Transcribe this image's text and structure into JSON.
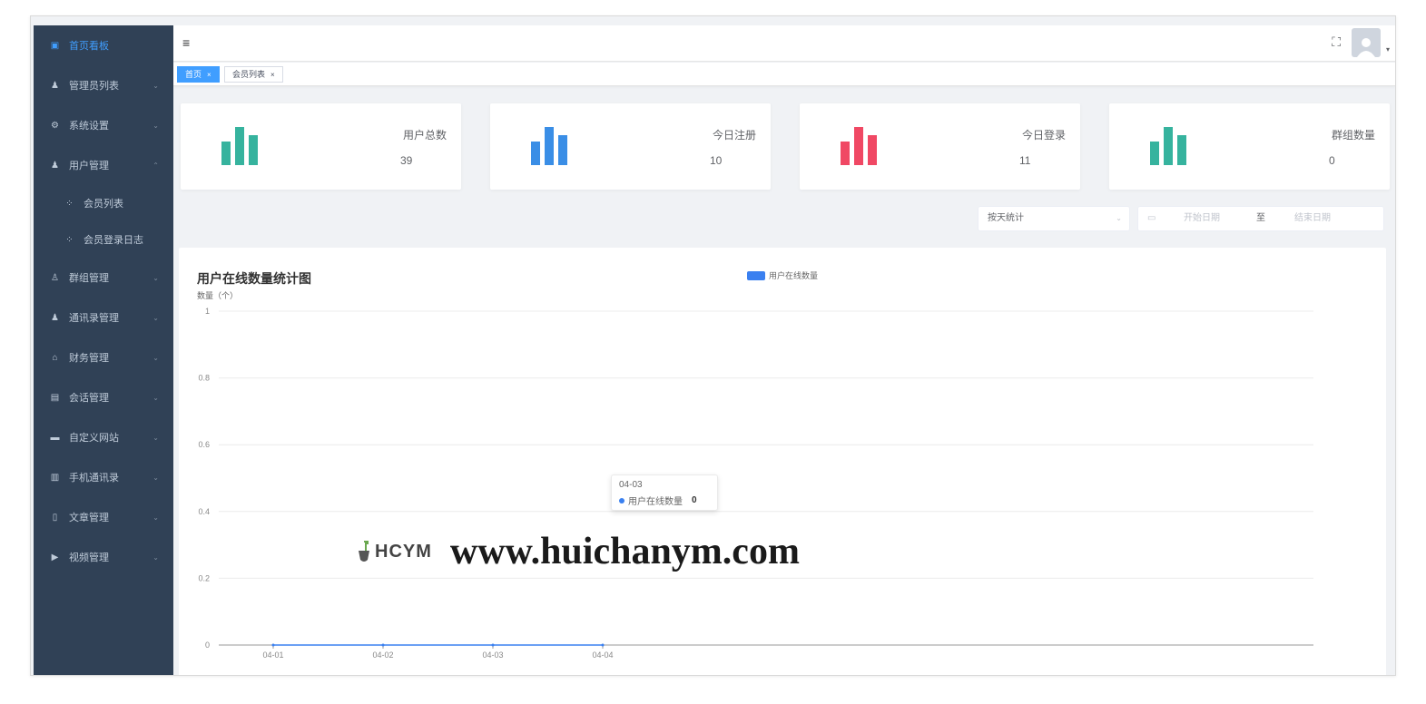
{
  "sidebar": {
    "items": [
      {
        "label": "首页看板",
        "icon": "dashboard-icon",
        "active": true,
        "arrow": ""
      },
      {
        "label": "管理员列表",
        "icon": "user-icon",
        "arrow": "⌄"
      },
      {
        "label": "系统设置",
        "icon": "gear-icon",
        "arrow": "⌄"
      },
      {
        "label": "用户管理",
        "icon": "user-icon",
        "arrow": "⌃"
      },
      {
        "label": "会员列表",
        "icon": "grid-icon",
        "sub": true,
        "arrow": ""
      },
      {
        "label": "会员登录日志",
        "icon": "grid-icon",
        "sub": true,
        "arrow": ""
      },
      {
        "label": "群组管理",
        "icon": "group-icon",
        "arrow": "⌄"
      },
      {
        "label": "通讯录管理",
        "icon": "contact-icon",
        "arrow": "⌄"
      },
      {
        "label": "财务管理",
        "icon": "finance-icon",
        "arrow": "⌄"
      },
      {
        "label": "会话管理",
        "icon": "chat-icon",
        "arrow": "⌄"
      },
      {
        "label": "自定义网站",
        "icon": "website-icon",
        "arrow": "⌄"
      },
      {
        "label": "手机通讯录",
        "icon": "phone-book-icon",
        "arrow": "⌄"
      },
      {
        "label": "文章管理",
        "icon": "article-icon",
        "arrow": "⌄"
      },
      {
        "label": "视频管理",
        "icon": "video-icon",
        "arrow": "⌄"
      }
    ]
  },
  "navbar": {
    "menu_icon": "≡",
    "fullscreen_icon": "⛶",
    "avatar_caret": "▾"
  },
  "tags": [
    {
      "label": "首页",
      "active": true,
      "close": "×"
    },
    {
      "label": "会员列表",
      "active": false,
      "close": "×"
    }
  ],
  "cards": [
    {
      "label": "用户总数",
      "value": "39",
      "color": "#36b39e"
    },
    {
      "label": "今日注册",
      "value": "10",
      "color": "#3a8ee6"
    },
    {
      "label": "今日登录",
      "value": "11",
      "color": "#f04864"
    },
    {
      "label": "群组数量",
      "value": "0",
      "color": "#36b39e"
    }
  ],
  "filters": {
    "mode": "按天统计",
    "arrow": "⌄",
    "calendar_icon": "▭",
    "start_placeholder": "开始日期",
    "separator": "至",
    "end_placeholder": "结束日期"
  },
  "chart_data": {
    "type": "line",
    "title": "用户在线数量统计图",
    "ylabel": "数量（个）",
    "categories": [
      "04-01",
      "04-02",
      "04-03",
      "04-04"
    ],
    "y_ticks": [
      "0",
      "0.2",
      "0.4",
      "0.6",
      "0.8",
      "1"
    ],
    "ylim": [
      0,
      1
    ],
    "grid": true,
    "legend_position": "top-center",
    "series": [
      {
        "name": "用户在线数量",
        "values": [
          0,
          0,
          0,
          0
        ],
        "color": "#3a80f0"
      }
    ]
  },
  "tooltip": {
    "date": "04-03",
    "series": "用户在线数量",
    "value": "0"
  },
  "watermark": {
    "logo": "HCYM",
    "shovel": "🥄",
    "url": "www.huichanym.com"
  }
}
